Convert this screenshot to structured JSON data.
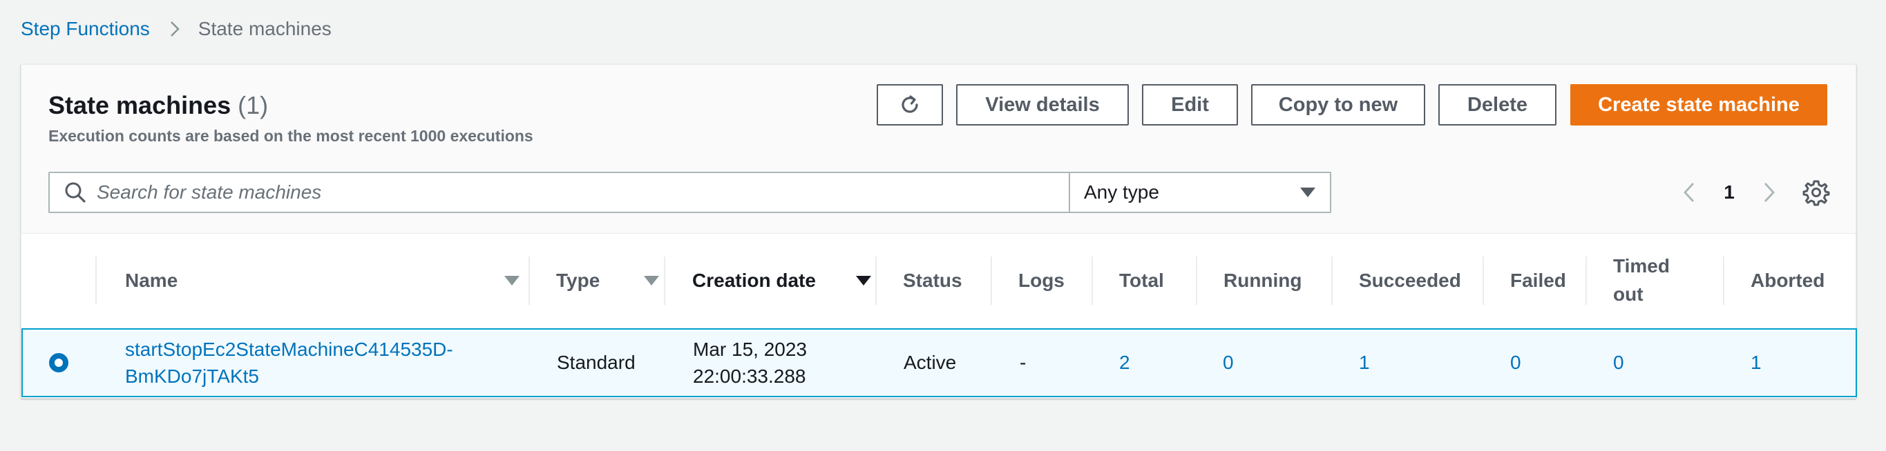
{
  "breadcrumb": {
    "parent": "Step Functions",
    "current": "State machines"
  },
  "panel": {
    "title": "State machines",
    "count": "(1)",
    "description": "Execution counts are based on the most recent 1000 executions"
  },
  "toolbar": {
    "refresh_icon": "refresh-icon",
    "view_details": "View details",
    "edit": "Edit",
    "copy_to_new": "Copy to new",
    "delete": "Delete",
    "create": "Create state machine"
  },
  "search": {
    "placeholder": "Search for state machines"
  },
  "filter": {
    "selected": "Any type"
  },
  "pagination": {
    "page": "1"
  },
  "table": {
    "headers": {
      "name": "Name",
      "type": "Type",
      "creation_date": "Creation date",
      "status": "Status",
      "logs": "Logs",
      "total": "Total",
      "running": "Running",
      "succeeded": "Succeeded",
      "failed": "Failed",
      "timed_out_1": "Timed",
      "timed_out_2": "out",
      "aborted": "Aborted"
    },
    "rows": [
      {
        "selected": true,
        "name_line1": "startStopEc2StateMachineC414535D-",
        "name_line2": "BmKDo7jTAKt5",
        "type": "Standard",
        "date_line1": "Mar 15, 2023",
        "date_line2": "22:00:33.288",
        "status": "Active",
        "logs": "-",
        "total": "2",
        "running": "0",
        "succeeded": "1",
        "failed": "0",
        "timed_out": "0",
        "aborted": "1"
      }
    ]
  },
  "colors": {
    "primary": "#ec7211",
    "link": "#0073bb",
    "selected_row_bg": "#f1faff",
    "selected_row_border": "#00a1c9"
  }
}
